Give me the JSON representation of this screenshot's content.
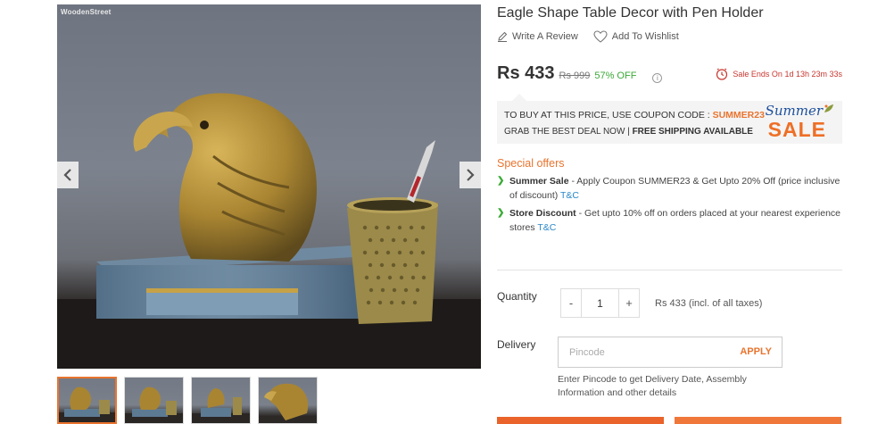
{
  "gallery": {
    "watermark": "WoodenStreet",
    "main_image_alt": "eagle-pen-holder-photo"
  },
  "product": {
    "title": "Eagle Shape Table Decor with Pen Holder",
    "write_review": "Write A Review",
    "add_wishlist": "Add To Wishlist"
  },
  "pricing": {
    "price": "Rs 433",
    "mrp": "Rs 999",
    "discount": "57% OFF",
    "info": "i",
    "sale_ends": "Sale Ends On 1d 13h 23m 33s"
  },
  "coupon": {
    "line1_prefix": "TO BUY AT THIS PRICE, USE COUPON CODE : ",
    "code": "SUMMER23",
    "line2_prefix": "GRAB THE BEST DEAL NOW | ",
    "line2_bold": "FREE SHIPPING AVAILABLE",
    "badge_top": "Summer",
    "badge_bottom": "SALE"
  },
  "offers": {
    "title": "Special offers",
    "items": [
      {
        "name": "Summer Sale",
        "text": " - Apply Coupon SUMMER23 & Get Upto 20% Off (price inclusive of discount) ",
        "link": "T&C"
      },
      {
        "name": "Store Discount",
        "text": " - Get upto 10% off on orders placed at your nearest experience stores ",
        "link": "T&C"
      }
    ]
  },
  "quantity": {
    "label": "Quantity",
    "minus": "-",
    "value": "1",
    "plus": "+",
    "note": "Rs 433 (incl. of all taxes)"
  },
  "delivery": {
    "label": "Delivery",
    "placeholder": "Pincode",
    "apply": "APPLY",
    "help": "Enter Pincode to get Delivery Date, Assembly Information and other details"
  },
  "colors": {
    "accent": "#e9742f",
    "green": "#3aaa35",
    "red": "#c8372f",
    "link": "#2b88c9"
  },
  "icons": {
    "review": "pencil-icon",
    "wishlist": "heart-icon",
    "timer": "clock-icon",
    "prev": "chevron-left-icon",
    "next": "chevron-right-icon"
  }
}
